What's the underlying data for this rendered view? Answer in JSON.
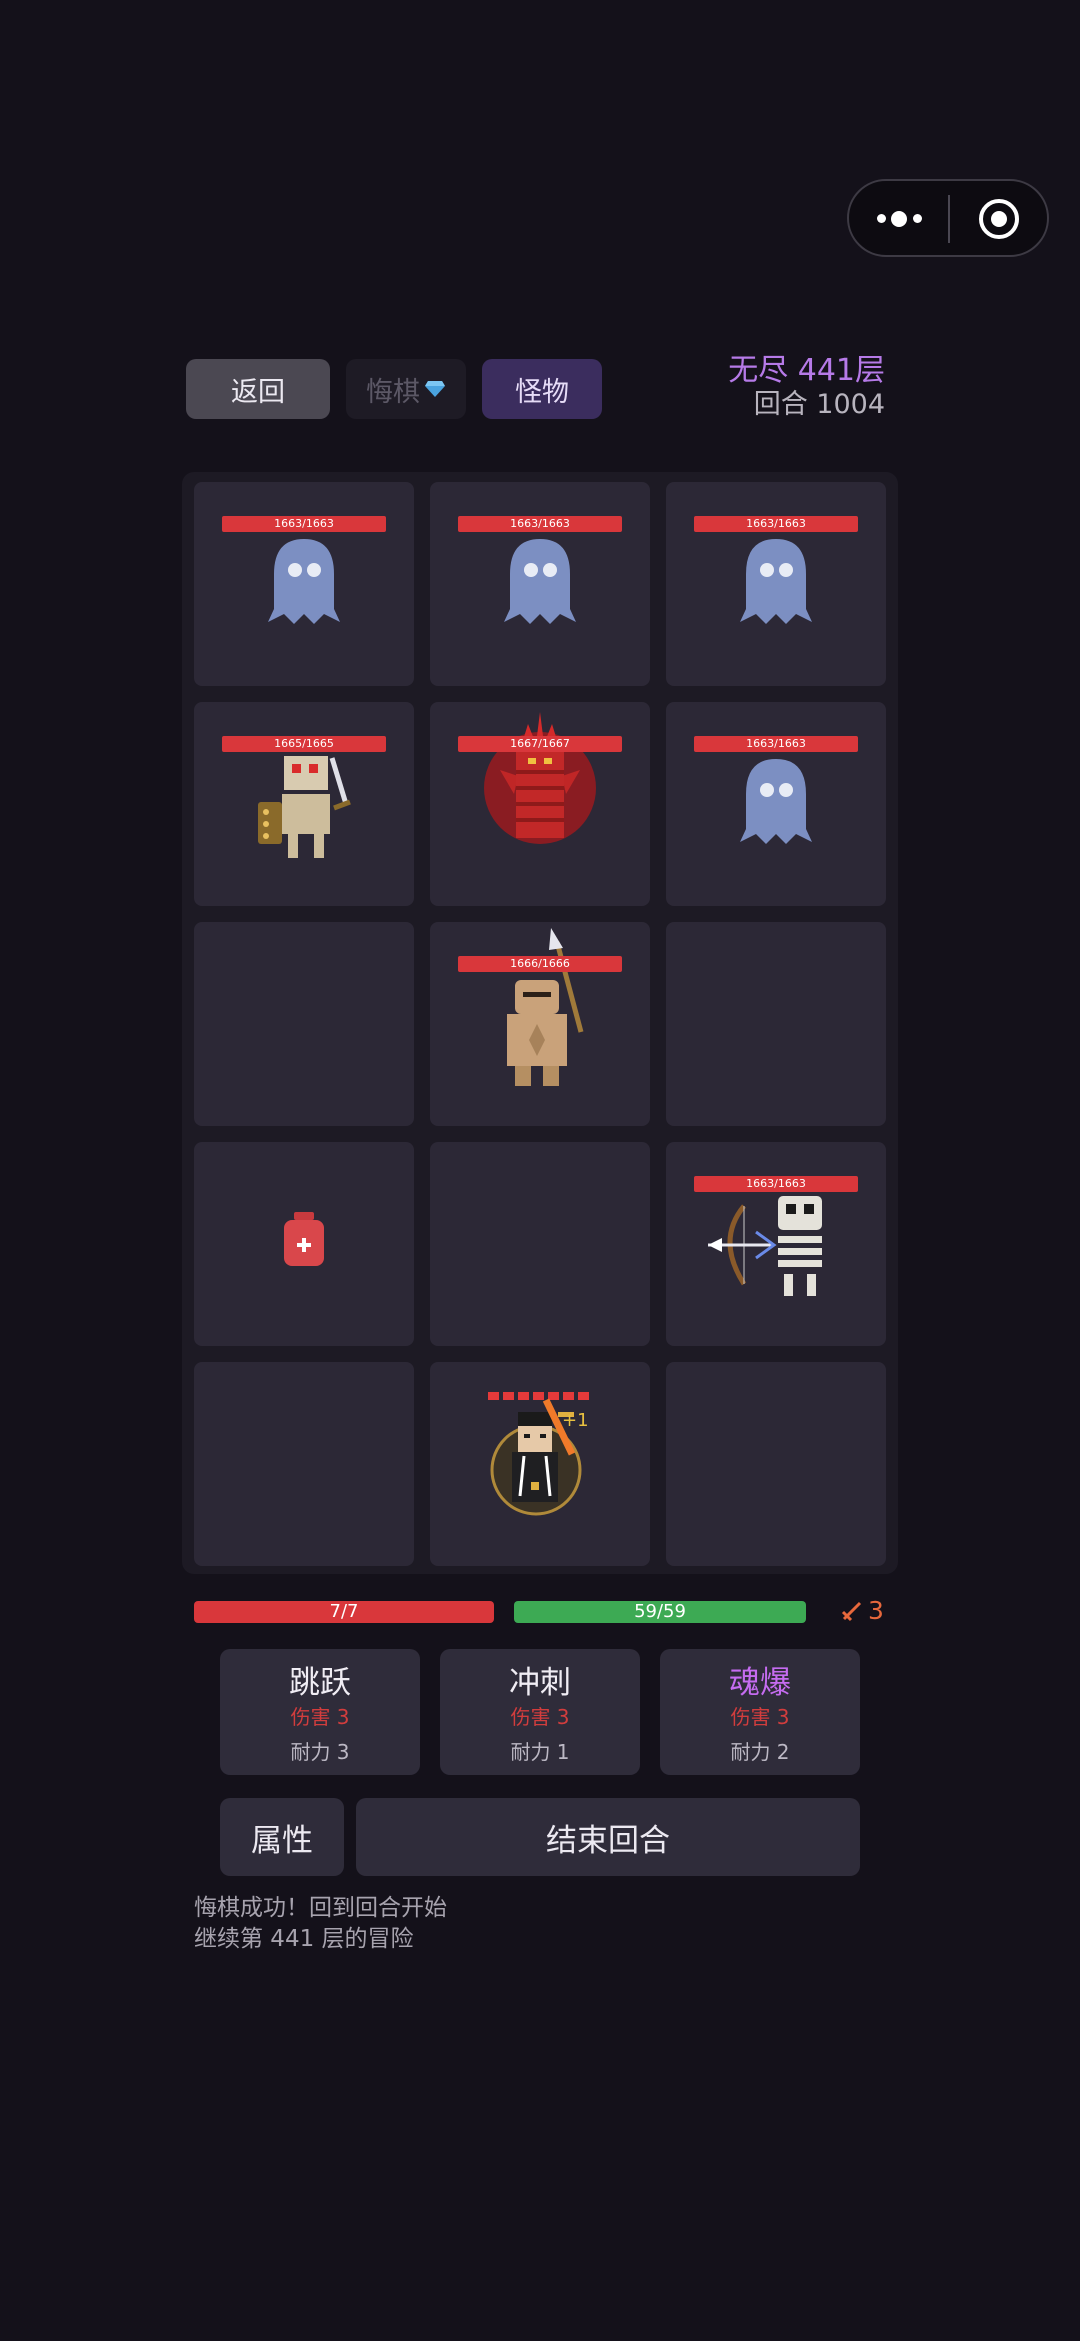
{
  "header": {
    "back_label": "返回",
    "undo_label": "悔棋",
    "monster_label": "怪物",
    "floor_text": "无尽 441层",
    "round_text": "回合 1004"
  },
  "board": {
    "cells": [
      {
        "hp": "1663/1663",
        "unit": "ghost"
      },
      {
        "hp": "1663/1663",
        "unit": "ghost"
      },
      {
        "hp": "1663/1663",
        "unit": "ghost"
      },
      {
        "hp": "1665/1665",
        "unit": "skeleton-warrior"
      },
      {
        "hp": "1667/1667",
        "unit": "flame-demon"
      },
      {
        "hp": "1663/1663",
        "unit": "ghost"
      },
      {
        "hp": "",
        "unit": "empty"
      },
      {
        "hp": "1666/1666",
        "unit": "spear-golem"
      },
      {
        "hp": "",
        "unit": "empty"
      },
      {
        "hp": "",
        "unit": "health-potion"
      },
      {
        "hp": "",
        "unit": "empty"
      },
      {
        "hp": "1663/1663",
        "unit": "skeleton-archer"
      },
      {
        "hp": "",
        "unit": "empty"
      },
      {
        "hp": "",
        "unit": "player-hero"
      },
      {
        "hp": "",
        "unit": "empty"
      }
    ],
    "player_hp_pips": 7,
    "player_buff": "+1"
  },
  "stats": {
    "hp": "7/7",
    "stamina": "59/59",
    "attack": "3",
    "hp_color": "#d9373b",
    "stamina_color": "#3daa54"
  },
  "skills": [
    {
      "name": "跳跃",
      "damage": "伤害 3",
      "durability": "耐力 3"
    },
    {
      "name": "冲刺",
      "damage": "伤害 3",
      "durability": "耐力 1"
    },
    {
      "name": "魂爆",
      "damage": "伤害 3",
      "durability": "耐力 2"
    }
  ],
  "actions": {
    "attributes_label": "属性",
    "end_turn_label": "结束回合"
  },
  "log": {
    "line1": "悔棋成功！回到回合开始",
    "line2": "继续第 441 层的冒险"
  }
}
